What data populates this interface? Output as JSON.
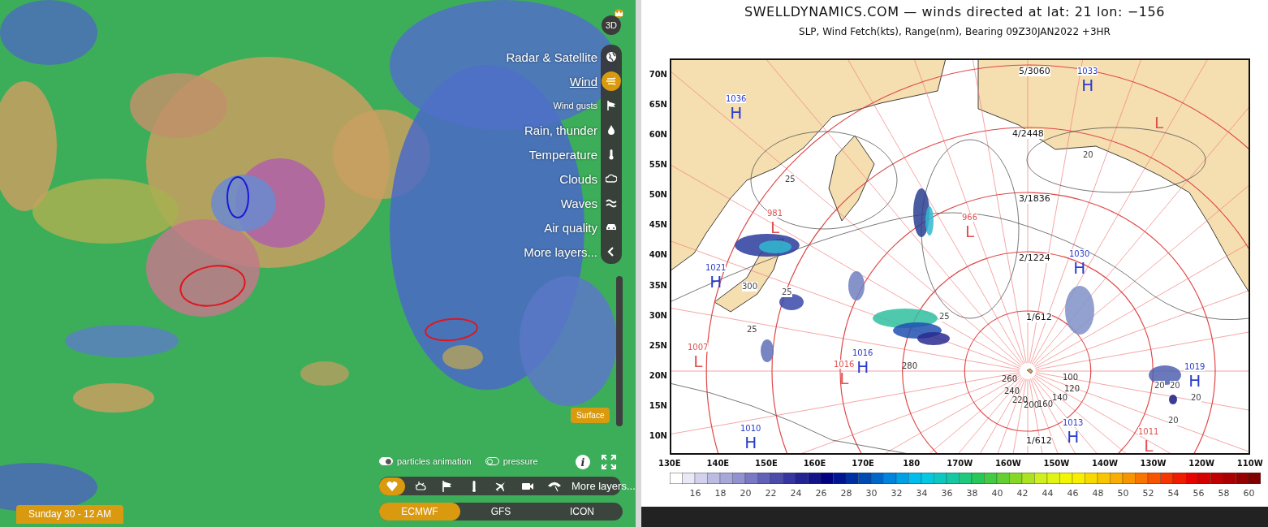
{
  "wind_map": {
    "three_d_button": "3D",
    "layers": [
      {
        "label": "Radar & Satellite",
        "kind": "main",
        "selected": false
      },
      {
        "label": "Wind",
        "kind": "main",
        "selected": true
      },
      {
        "label": "Wind gusts",
        "kind": "sub",
        "selected": false
      },
      {
        "label": "Rain, thunder",
        "kind": "main",
        "selected": false
      },
      {
        "label": "Temperature",
        "kind": "main",
        "selected": false
      },
      {
        "label": "Clouds",
        "kind": "main",
        "selected": false
      },
      {
        "label": "Waves",
        "kind": "main",
        "selected": false
      },
      {
        "label": "Air quality",
        "kind": "main",
        "selected": false
      },
      {
        "label": "More layers...",
        "kind": "main",
        "selected": false
      }
    ],
    "annotations": [
      {
        "color": "#e3141c"
      },
      {
        "color": "#1a1ad8"
      },
      {
        "color": "#e3141c"
      }
    ],
    "level_badge": "Surface",
    "toggles": [
      {
        "label": "particles animation",
        "on": true
      },
      {
        "label": "pressure",
        "on": false
      }
    ],
    "info_button": "i",
    "overlay_bar": {
      "items": [
        {
          "selected": true
        },
        {
          "selected": false
        },
        {
          "selected": false
        },
        {
          "selected": false
        },
        {
          "selected": false
        },
        {
          "selected": false
        },
        {
          "selected": false
        }
      ],
      "more": "More layers..."
    },
    "models": [
      {
        "label": "ECMWF",
        "selected": true
      },
      {
        "label": "GFS",
        "selected": false
      },
      {
        "label": "ICON",
        "selected": false
      }
    ],
    "time": "Sunday 30 - 12 AM"
  },
  "swell_chart": {
    "title": "SWELLDYNAMICS.COM — winds directed at lat: 21 lon: −156",
    "subtitle": "SLP, Wind Fetch(kts), Range(nm), Bearing 09Z30JAN2022 +3HR",
    "lat_labels": [
      "70N",
      "65N",
      "60N",
      "55N",
      "50N",
      "45N",
      "40N",
      "35N",
      "30N",
      "25N",
      "20N",
      "15N",
      "10N"
    ],
    "lon_labels": [
      "130E",
      "140E",
      "150E",
      "160E",
      "170E",
      "180",
      "170W",
      "160W",
      "150W",
      "140W",
      "130W",
      "120W",
      "110W"
    ],
    "range_labels": [
      "5/3060",
      "4/2448",
      "3/1836",
      "2/1224",
      "1/612",
      "1/612"
    ],
    "bearing_labels": [
      "280",
      "260",
      "240",
      "220",
      "200",
      "160",
      "140",
      "120",
      "100"
    ],
    "contour_labels": [
      "20",
      "25",
      "300",
      "25",
      "25",
      "25",
      "20",
      "20",
      "20",
      "20"
    ],
    "pressure_centers": [
      {
        "type": "H",
        "value": "1033"
      },
      {
        "type": "H",
        "value": "1036"
      },
      {
        "type": "L",
        "value": "981"
      },
      {
        "type": "L",
        "value": "966"
      },
      {
        "type": "H",
        "value": "1021"
      },
      {
        "type": "H",
        "value": "1030"
      },
      {
        "type": "L",
        "value": "1007"
      },
      {
        "type": "L",
        "value": "1016"
      },
      {
        "type": "H",
        "value": "1016"
      },
      {
        "type": "H",
        "value": "1019"
      },
      {
        "type": "H",
        "value": "1010"
      },
      {
        "type": "H",
        "value": "1013"
      },
      {
        "type": "L",
        "value": "1011"
      },
      {
        "type": "L"
      }
    ],
    "colorbar_labels": [
      "16",
      "18",
      "20",
      "22",
      "24",
      "26",
      "28",
      "30",
      "32",
      "34",
      "36",
      "38",
      "40",
      "42",
      "44",
      "46",
      "48",
      "50",
      "52",
      "54",
      "56",
      "58",
      "60"
    ]
  }
}
